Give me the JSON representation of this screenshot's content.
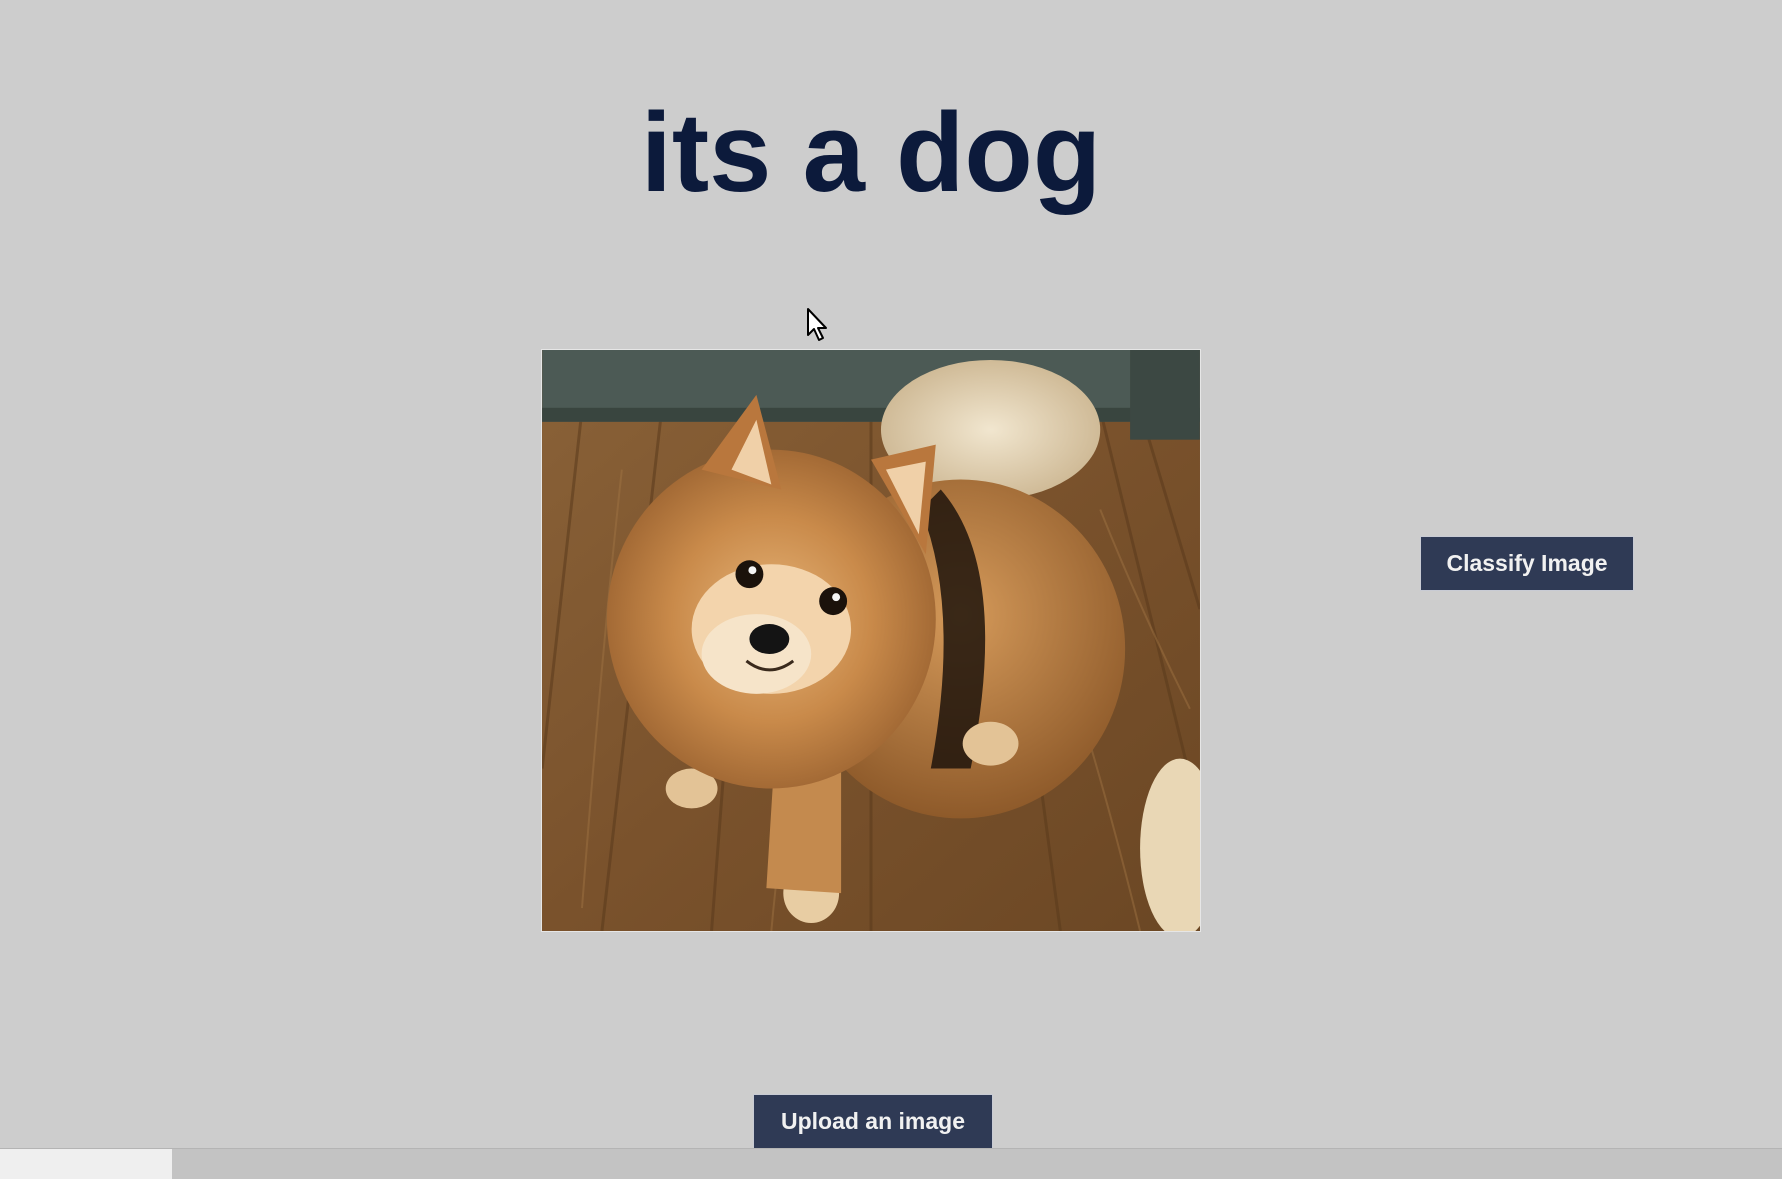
{
  "page": {
    "title": "its a dog",
    "background_color": "#cdcdcd",
    "title_color": "#0c1a3b"
  },
  "image": {
    "alt": "Photo of a fluffy Pomeranian dog on a wooden floor"
  },
  "buttons": {
    "classify_label": "Classify Image",
    "upload_label": "Upload an image",
    "color": "#2f3a55"
  },
  "cursor": {
    "icon": "mouse-pointer-icon"
  }
}
